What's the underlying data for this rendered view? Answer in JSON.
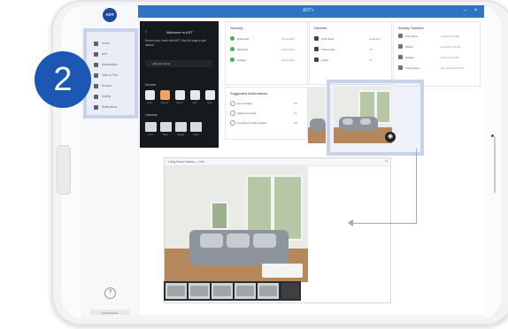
{
  "app": {
    "logo_text": "ADT",
    "window_title": "ADT+",
    "accent_color": "#2f73c4",
    "help_symbol": "?",
    "footer_label": "Control Panel"
  },
  "step": {
    "number": "2"
  },
  "sidebar": {
    "items": [
      {
        "label": "Home",
        "icon": "home-icon"
      },
      {
        "label": "Arm",
        "icon": "shield-icon"
      },
      {
        "label": "Automations",
        "icon": "automation-icon"
      },
      {
        "label": "Video & Pics",
        "icon": "camera-icon"
      },
      {
        "label": "Devices",
        "icon": "devices-icon"
      },
      {
        "label": "Activity",
        "icon": "activity-icon"
      },
      {
        "label": "Notifications",
        "icon": "bell-icon"
      }
    ]
  },
  "panel": {
    "title": "Welcome to ADT",
    "subtitle": "Secure your home with ADT. Now it's easy to get started.",
    "field_label": "Add your home",
    "row1_title": "Devices",
    "row2_title": "Cameras",
    "tiles": [
      "Lock",
      "Camera",
      "Sensor",
      "Light",
      "Door"
    ],
    "thumbs": [
      "Front",
      "Back",
      "Garage",
      "Living"
    ]
  },
  "cards": {
    "status": {
      "title": "Security",
      "rows": [
        {
          "label": "Disarmed",
          "value": "Connected"
        },
        {
          "label": "All Doors",
          "value": "Connected"
        },
        {
          "label": "Garage",
          "value": "Connected"
        }
      ]
    },
    "devices": {
      "title": "Devices",
      "rows": [
        {
          "label": "Front Door",
          "value": "Unlocked"
        },
        {
          "label": "Thermostat",
          "value": "72°"
        },
        {
          "label": "Lights",
          "value": "On"
        }
      ]
    },
    "activity": {
      "title": "Activity Timeline",
      "rows": [
        {
          "label": "Front Door",
          "time": "Opened 2:42 PM"
        },
        {
          "label": "Motion",
          "time": "Detected 2:31 PM"
        },
        {
          "label": "Garage",
          "time": "Closed 1:15 PM"
        },
        {
          "label": "Living Room",
          "time": "Clip saved 12:04 PM"
        }
      ]
    },
    "automation": {
      "title": "Suggested Automations",
      "rows": [
        {
          "label": "Arm at Night",
          "value": "Off"
        },
        {
          "label": "Lights on Arrival",
          "value": "On"
        },
        {
          "label": "Lock Doors when Armed",
          "value": "Off"
        }
      ]
    }
  },
  "viewer": {
    "label": "Living Room Camera — Live",
    "close": "×"
  }
}
